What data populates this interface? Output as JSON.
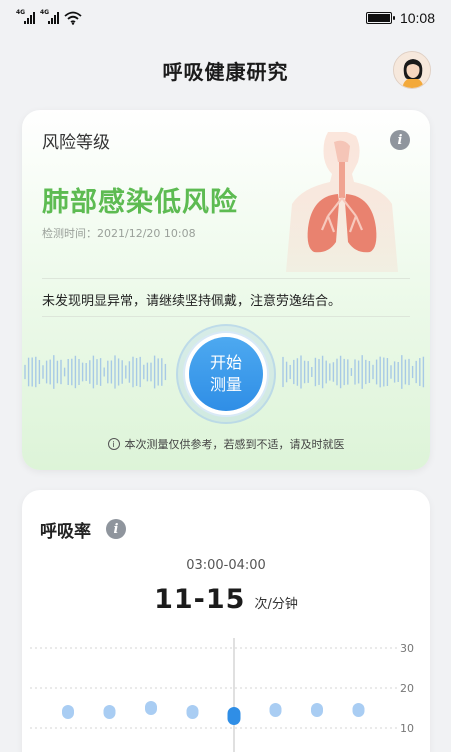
{
  "status_bar": {
    "signal1": "4G",
    "signal2": "4G",
    "time": "10:08"
  },
  "header": {
    "title": "呼吸健康研究"
  },
  "risk_card": {
    "label": "风险等级",
    "level": "肺部感染低风险",
    "detect_time": "检测时间：2021/12/20 10:08",
    "note": "未发现明显异常，请继续坚持佩戴，注意劳逸结合。",
    "measure_button_line1": "开始",
    "measure_button_line2": "测量",
    "disclaimer": "本次测量仅供参考，若感到不适，请及时就医",
    "level_color": "#5dbb52"
  },
  "breath_card": {
    "title": "呼吸率",
    "time_range": "03:00-04:00",
    "rate_value": "11-15",
    "rate_unit": "次/分钟"
  },
  "chart_data": {
    "type": "scatter",
    "y_ticks": [
      "30",
      "20",
      "10"
    ],
    "ylim": [
      0,
      30
    ],
    "values": [
      14,
      14,
      15,
      14,
      13,
      14.5,
      14.5,
      14.5
    ],
    "selected_index": 4,
    "point_color": "#a9cdf3",
    "selected_color": "#2f8ee6"
  }
}
